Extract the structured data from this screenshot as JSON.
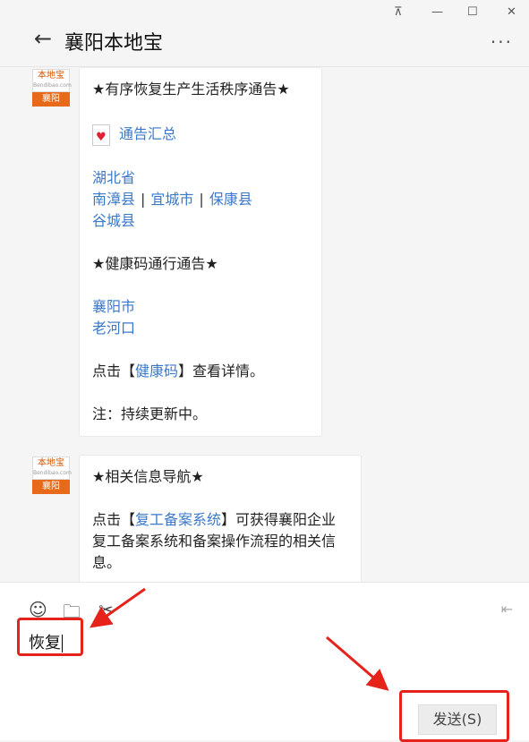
{
  "window": {
    "pin": "⊼",
    "minimize": "—",
    "maximize": "☐",
    "close": "✕"
  },
  "header": {
    "back": "←",
    "title": "襄阳本地宝",
    "more": "···"
  },
  "avatar": {
    "brand": "本地宝",
    "domain": "Bendibao.com",
    "city": "襄阳"
  },
  "messages": [
    {
      "heading": "★有序恢复生产生活秩序通告★",
      "notice_link": "通告汇总",
      "province": "湖北省",
      "counties_row1": [
        "南漳县",
        "宜城市",
        "保康县"
      ],
      "counties_row2": "谷城县",
      "sep": "|",
      "health_heading": "★健康码通行通告★",
      "health_links": [
        "襄阳市",
        "老河口"
      ],
      "click_prefix": "点击【",
      "health_code_link": "健康码",
      "click_suffix": "】查看详情。",
      "note": "注：持续更新中。"
    },
    {
      "heading": "★相关信息导航★",
      "click_prefix": "点击【",
      "link": "复工备案系统",
      "suffix": "】可获得襄阳企业复工备案系统和备案操作流程的相关信息。"
    }
  ],
  "input": {
    "emoji_icon": "☺",
    "folder_icon": "🗀",
    "scissors_icon": "✂",
    "list_icon": "⇤",
    "value": "恢复",
    "send_label": "发送(S)"
  },
  "colors": {
    "link": "#3a79c9",
    "highlight": "#e5231b",
    "avatar_orange": "#e66a1a"
  }
}
